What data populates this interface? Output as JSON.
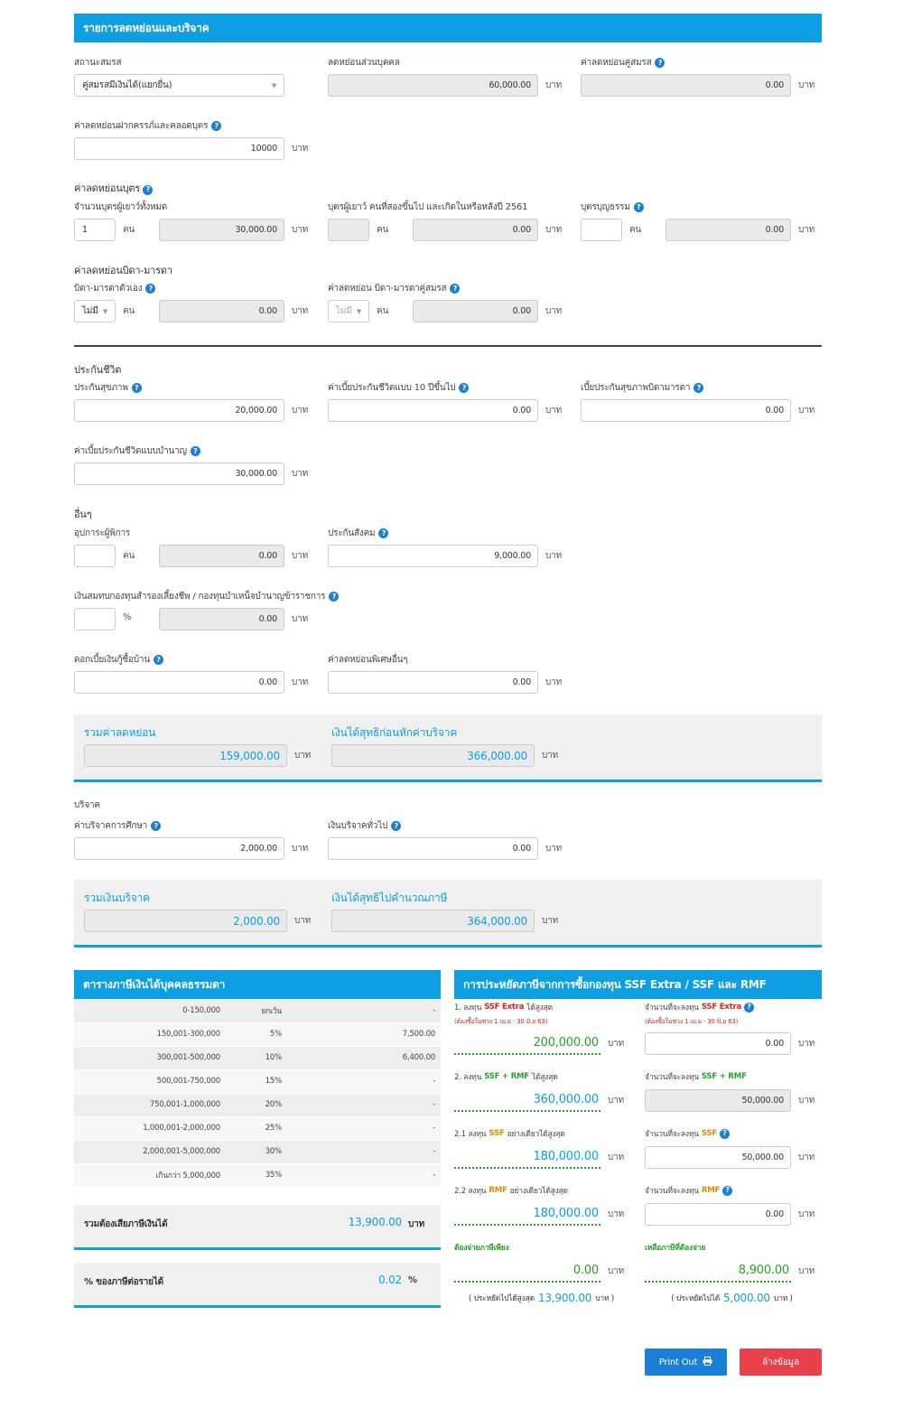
{
  "deduction": {
    "header": "รายการลดหย่อนและบริจาค",
    "marital_label": "สถานะสมรส",
    "marital_value": "คู่สมรสมีเงินได้(แยกยื่น)",
    "personal_label": "ลดหย่อนส่วนบุคคล",
    "personal_value": "60,000.00",
    "spouse_label": "ค่าลดหย่อนคู่สมรส",
    "spouse_value": "0.00",
    "pregnancy_label": "ค่าลดหย่อนฝากครรภ์และคลอดบุตร",
    "pregnancy_value": "10000",
    "unit_baht": "บาท",
    "unit_person": "คน",
    "unit_percent": "%",
    "children_section": "ค่าลดหย่อนบุตร",
    "children_total_label": "จำนวนบุตรผู้เยาว์ทั้งหมด",
    "children_total_count": "1",
    "children_total_value": "30,000.00",
    "children_2561_label": "บุตรผู้เยาว์ คนที่สองขึ้นไป และเกิดในหรือหลังปี 2561",
    "children_2561_count": "",
    "children_2561_value": "0.00",
    "children_adopted_label": "บุตรบุญธรรม",
    "children_adopted_count": "",
    "children_adopted_value": "0.00",
    "parents_section": "ค่าลดหย่อนบิดา-มารดา",
    "parents_own_label": "บิดา-มารดาตัวเอง",
    "parents_own_select": "ไม่มี",
    "parents_own_value": "0.00",
    "parents_spouse_label": "ค่าลดหย่อน บิดา-มารดาคู่สมรส",
    "parents_spouse_select": "ไม่มี",
    "parents_spouse_value": "0.00",
    "insurance_section": "ประกันชีวิต",
    "health_label": "ประกันสุขภาพ",
    "health_value": "20,000.00",
    "life10_label": "ค่าเบี้ยประกันชีวิตแบบ 10 ปีขึ้นไป",
    "life10_value": "0.00",
    "parent_health_label": "เบี้ยประกันสุขภาพบิดามารดา",
    "parent_health_value": "0.00",
    "pension_label": "ค่าเบี้ยประกันชีวิตแบบบำนาญ",
    "pension_value": "30,000.00",
    "other_section": "อื่นๆ",
    "disabled_label": "อุปการะผู้พิการ",
    "disabled_count": "",
    "disabled_value": "0.00",
    "social_label": "ประกันสังคม",
    "social_value": "9,000.00",
    "fund_label": "เงินสมทบกองทุนสำรองเลี้ยงชีพ / กองทุนบำเหน็จบำนาญข้าราชการ",
    "fund_percent": "",
    "fund_value": "0.00",
    "mortgage_label": "ดอกเบี้ยเงินกู้ซื้อบ้าน",
    "mortgage_value": "0.00",
    "special_label": "ค่าลดหย่อนพิเศษอื่นๆ",
    "special_value": "0.00"
  },
  "summary1": {
    "total_label": "รวมค่าลดหย่อน",
    "total_value": "159,000.00",
    "net_label": "เงินได้สุทธิก่อนหักค่าบริจาค",
    "net_value": "366,000.00"
  },
  "donation": {
    "section": "บริจาค",
    "edu_label": "ค่าบริจาคการศึกษา",
    "edu_value": "2,000.00",
    "general_label": "เงินบริจาคทั่วไป",
    "general_value": "0.00"
  },
  "summary2": {
    "total_label": "รวมเงินบริจาค",
    "total_value": "2,000.00",
    "net_label": "เงินได้สุทธิไปคำนวณภาษี",
    "net_value": "364,000.00"
  },
  "tax_table": {
    "header": "ตารางภาษีเงินได้บุคคลธรรมดา",
    "rows": [
      {
        "range": "0-150,000",
        "rate": "ยกเว้น",
        "tax": "-"
      },
      {
        "range": "150,001-300,000",
        "rate": "5%",
        "tax": "7,500.00"
      },
      {
        "range": "300,001-500,000",
        "rate": "10%",
        "tax": "6,400.00"
      },
      {
        "range": "500,001-750,000",
        "rate": "15%",
        "tax": "-"
      },
      {
        "range": "750,001-1,000,000",
        "rate": "20%",
        "tax": "-"
      },
      {
        "range": "1,000,001-2,000,000",
        "rate": "25%",
        "tax": "-"
      },
      {
        "range": "2,000,001-5,000,000",
        "rate": "30%",
        "tax": "-"
      },
      {
        "range": "เกินกว่า 5,000,000",
        "rate": "35%",
        "tax": "-"
      }
    ],
    "total_label": "รวมต้องเสียภาษีเงินได้",
    "total_value": "13,900.00",
    "percent_label": "% ของภาษีต่อรายได้",
    "percent_value": "0.02"
  },
  "ssf": {
    "header": "การประหยัดภาษีจากการซื้อกองทุน SSF Extra / SSF และ RMF",
    "l1_pre": "1. ลงทุน",
    "l1_fund": "SSF Extra",
    "l1_post": "ได้สูงสุด",
    "l1_note": "(ต้องซื้อในช่วง 1 เม.ย - 30 มิ.ย 63)",
    "l1_value": "200,000.00",
    "r1_pre": "จำนวนที่จะลงทุน",
    "r1_fund": "SSF Extra",
    "r1_note": "(ต้องซื้อในช่วง 1 เม.ย - 30 มิ.ย 63)",
    "r1_value": "0.00",
    "l2_pre": "2. ลงทุน",
    "l2_fund": "SSF + RMF",
    "l2_post": "ได้สูงสุด",
    "l2_value": "360,000.00",
    "r2_pre": "จำนวนที่จะลงทุน",
    "r2_fund": "SSF + RMF",
    "r2_value": "50,000.00",
    "l3_pre": "2.1 ลงทุน",
    "l3_fund": "SSF",
    "l3_post": "อย่างเดียวได้สูงสุด",
    "l3_value": "180,000.00",
    "r3_pre": "จำนวนที่จะลงทุน",
    "r3_fund": "SSF",
    "r3_value": "50,000.00",
    "l4_pre": "2.2 ลงทุน",
    "l4_fund": "RMF",
    "l4_post": "อย่างเดียวได้สูงสุด",
    "l4_value": "180,000.00",
    "r4_pre": "จำนวนที่จะลงทุน",
    "r4_fund": "RMF",
    "r4_value": "0.00",
    "pay_only_label": "ต้องจ่ายภาษีเพียง",
    "pay_only_value": "0.00",
    "remain_label": "เหลือภาษีที่ต้องจ่าย",
    "remain_value": "8,900.00",
    "save_max_pre": "( ประหยัดไปได้สูงสุด",
    "save_max_value": "13,900.00",
    "save_max_post": "บาท )",
    "save_pre": "( ประหยัดไปได้",
    "save_value": "5,000.00",
    "save_post": "บาท )"
  },
  "buttons": {
    "print": "Print Out",
    "clear": "ล้างข้อมูล"
  },
  "colors": {
    "accent": "#0d9fe2",
    "green": "#2a9d2a",
    "red": "#e02020",
    "orange": "#e08a00",
    "clear_button": "#e8414b",
    "print_button": "#1a7fd6"
  }
}
